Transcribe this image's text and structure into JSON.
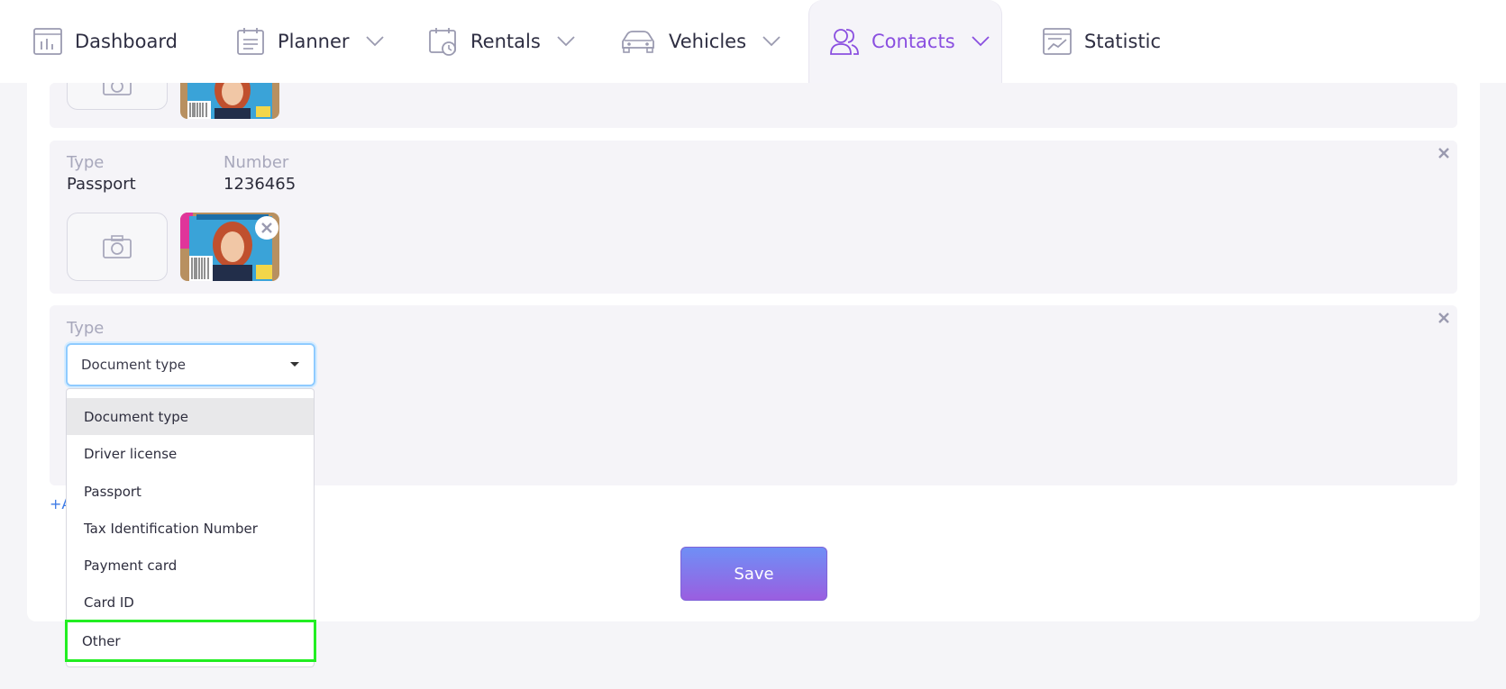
{
  "nav": {
    "items": [
      {
        "label": "Dashboard",
        "icon": "dashboard-icon"
      },
      {
        "label": "Planner",
        "icon": "planner-icon"
      },
      {
        "label": "Rentals",
        "icon": "rentals-icon"
      },
      {
        "label": "Vehicles",
        "icon": "vehicles-icon"
      },
      {
        "label": "Contacts",
        "icon": "contacts-icon"
      },
      {
        "label": "Statistic",
        "icon": "statistic-icon"
      }
    ],
    "active": "Contacts",
    "accent": "#8a4fe0"
  },
  "documents": [
    {
      "type_label": "Type",
      "type_value": "Passport",
      "number_label": "Number",
      "number_value": "1236465"
    }
  ],
  "new_document": {
    "type_label": "Type",
    "select_value": "Document type",
    "options": [
      "Document type",
      "Driver license",
      "Passport",
      "Tax Identification Number",
      "Payment card",
      "Card ID",
      "Other"
    ],
    "highlighted_option": "Other"
  },
  "add_link": "+A",
  "save_label": "Save",
  "colors": {
    "save_gradient_top": "#6f8ff6",
    "save_gradient_bottom": "#9a5ee0",
    "highlight": "#22ee22"
  }
}
